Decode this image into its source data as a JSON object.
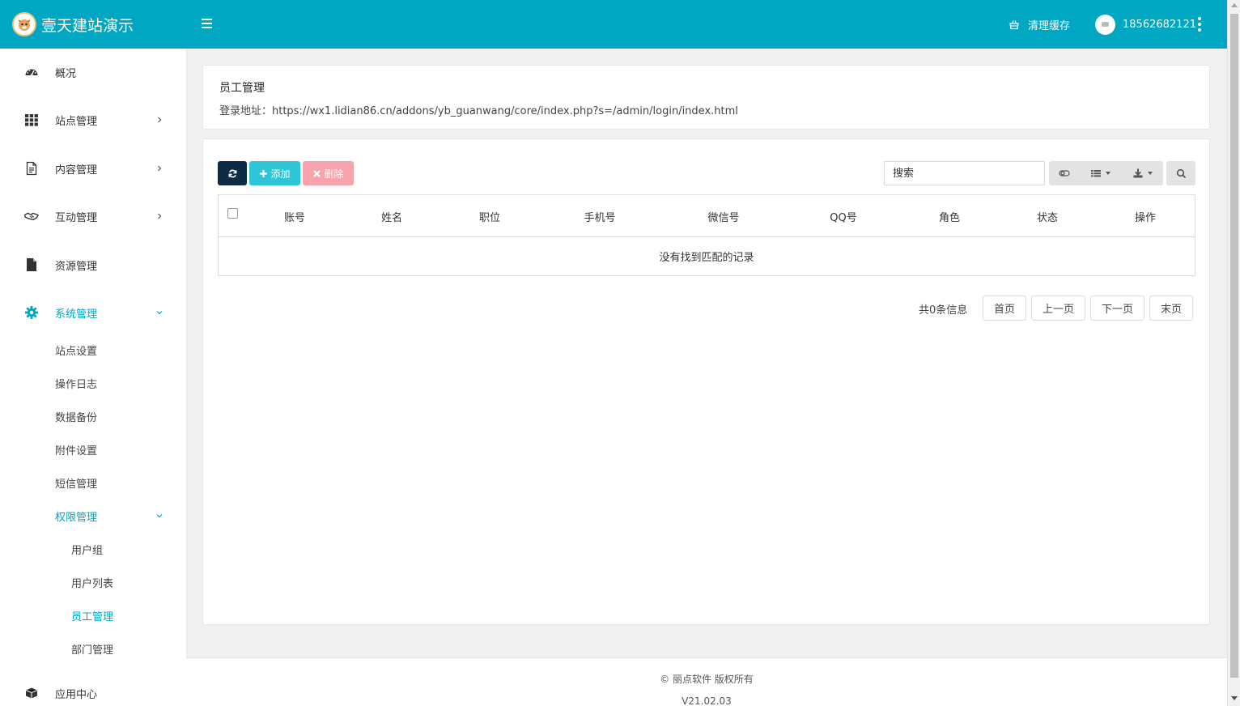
{
  "header": {
    "logo_text": "壹天建站演示",
    "clear_cache": "清理缓存",
    "user_name": "18562682121"
  },
  "sidebar": {
    "items": [
      {
        "label": "概况"
      },
      {
        "label": "站点管理"
      },
      {
        "label": "内容管理"
      },
      {
        "label": "互动管理"
      },
      {
        "label": "资源管理"
      },
      {
        "label": "系统管理"
      },
      {
        "label": "应用中心"
      }
    ],
    "system_sub": [
      {
        "label": "站点设置"
      },
      {
        "label": "操作日志"
      },
      {
        "label": "数据备份"
      },
      {
        "label": "附件设置"
      },
      {
        "label": "短信管理"
      },
      {
        "label": "权限管理"
      }
    ],
    "permission_sub": [
      {
        "label": "用户组"
      },
      {
        "label": "用户列表"
      },
      {
        "label": "员工管理"
      },
      {
        "label": "部门管理"
      }
    ]
  },
  "page": {
    "title": "员工管理",
    "login_url": "登录地址：https://wx1.lidian86.cn/addons/yb_guanwang/core/index.php?s=/admin/login/index.html"
  },
  "toolbar": {
    "add_label": "添加",
    "delete_label": "删除",
    "search_placeholder": "搜索"
  },
  "table": {
    "columns": [
      "账号",
      "姓名",
      "职位",
      "手机号",
      "微信号",
      "QQ号",
      "角色",
      "状态",
      "操作"
    ],
    "empty_text": "没有找到匹配的记录"
  },
  "pager": {
    "total": "共0条信息",
    "first": "首页",
    "prev": "上一页",
    "next": "下一页",
    "last": "末页"
  },
  "footer": {
    "copyright": "© 丽点软件 版权所有",
    "version": "V21.02.03"
  },
  "colors": {
    "accent": "#00a7c2",
    "add_button": "#2ec5d6",
    "delete_button": "#f7a3ae",
    "refresh_button": "#0d2b45"
  }
}
